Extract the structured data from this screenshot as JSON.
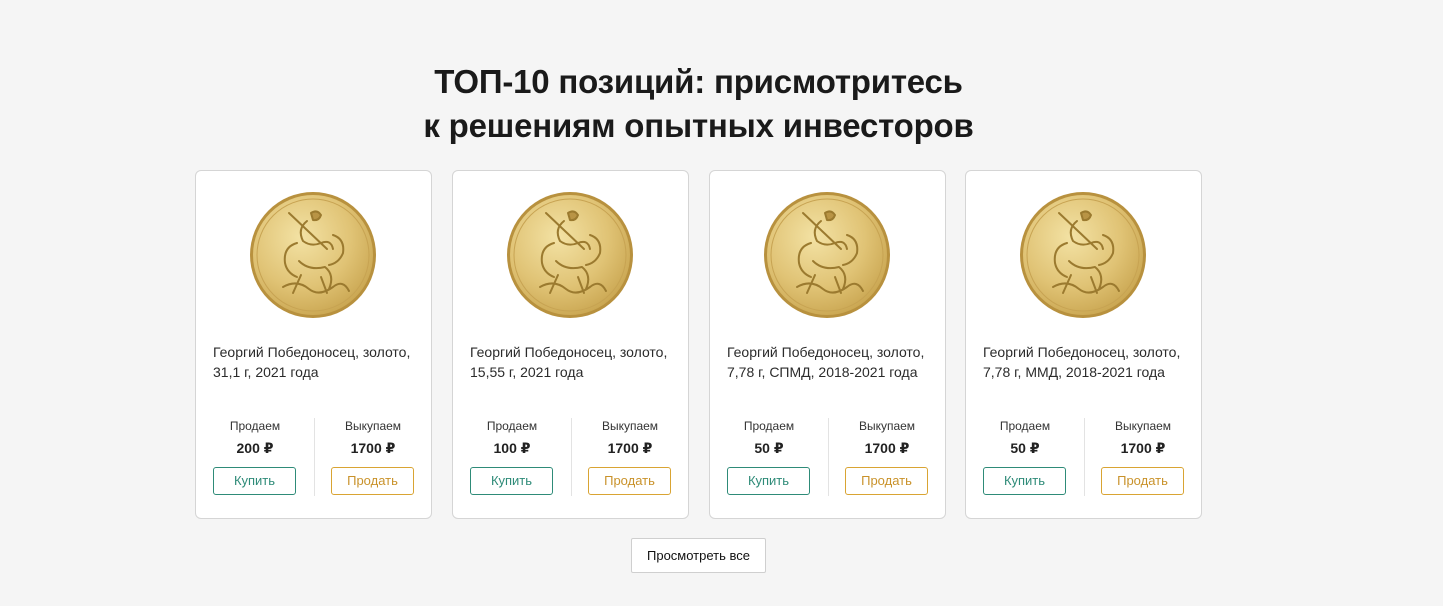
{
  "heading": {
    "line1": "ТОП-10 позиций: присмотритесь",
    "line2": "к решениям опытных инвесторов"
  },
  "cards": [
    {
      "name": "Георгий Победоносец, золото, 31,1 г, 2021 года",
      "sell_label": "Продаем",
      "sell_price": "200 ₽",
      "buy_label": "Выкупаем",
      "buy_price": "1700 ₽",
      "buy_button": "Купить",
      "sell_button": "Продать"
    },
    {
      "name": "Георгий Победоносец, золото, 15,55 г, 2021 года",
      "sell_label": "Продаем",
      "sell_price": "100 ₽",
      "buy_label": "Выкупаем",
      "buy_price": "1700 ₽",
      "buy_button": "Купить",
      "sell_button": "Продать"
    },
    {
      "name": "Георгий Победоносец, золото, 7,78 г, СПМД, 2018-2021 года",
      "sell_label": "Продаем",
      "sell_price": "50 ₽",
      "buy_label": "Выкупаем",
      "buy_price": "1700 ₽",
      "buy_button": "Купить",
      "sell_button": "Продать"
    },
    {
      "name": "Георгий Победоносец, золото, 7,78 г, ММД, 2018-2021 года",
      "sell_label": "Продаем",
      "sell_price": "50 ₽",
      "buy_label": "Выкупаем",
      "buy_price": "1700 ₽",
      "buy_button": "Купить",
      "sell_button": "Продать"
    }
  ],
  "view_all_button": "Просмотреть все",
  "icons": {
    "coin": "gold-coin-st-george-icon"
  },
  "colors": {
    "buy": "#2e8b78",
    "sell": "#d9a433",
    "background": "#f5f5f5",
    "coin_gold": "#e2c679"
  }
}
